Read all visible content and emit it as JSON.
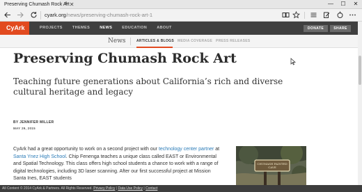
{
  "browser": {
    "tab_title": "Preserving Chumash Rock Art",
    "url_domain": "cyark.org",
    "url_path": "/news/preserving-chumash-rock-art-1",
    "new_tab": "+",
    "win_minimize": "—",
    "win_maximize": "☐",
    "win_close": "✕",
    "tab_close": "✕"
  },
  "site": {
    "logo": "CyArk",
    "nav": [
      "PROJECTS",
      "THEMES",
      "NEWS",
      "EDUCATION",
      "ABOUT"
    ],
    "active_nav": "NEWS",
    "donate": "DONATE",
    "share": "SHARE"
  },
  "subnav": {
    "title": "News",
    "links": [
      "ARTICLES & BLOGS",
      "MEDIA COVERAGE",
      "PRESS RELEASES"
    ]
  },
  "article": {
    "title": "Preserving Chumash Rock Art",
    "subtitle": "Teaching future generations about California’s rich and diverse cultural heritage and legacy",
    "byline": "BY JENNIFER MILLER",
    "date": "MAY 29, 2015",
    "body_1": "CyArk had a great opportunity to work on a second project with our ",
    "link_1": "technology center partner",
    "body_2": " at ",
    "link_2": "Santa Ynez High School",
    "body_3": ". Chip Fenenga teaches a unique class called EAST or Environmental and Spatial Technology. This class offers high school students a chance to work with a range of digital technologies, including 3D laser scanning. After our first successful project at Mission Santa Ines, EAST students",
    "photo_sign": "CHUMASH PAINTED CAVE"
  },
  "footer": {
    "copyright": "All Content © 2014 CyArk & Partners. All Rights Reserved. ",
    "privacy": "Privacy Policy",
    "sep": " | ",
    "data_use": "Data Use Policy",
    "contact": "Contact"
  },
  "icons": {
    "back": "back-arrow-icon",
    "forward": "forward-arrow-icon",
    "refresh": "refresh-icon",
    "reading_view": "reading-view-icon",
    "favorite": "star-icon",
    "hub": "hub-icon",
    "web_note": "web-note-icon",
    "share": "share-icon",
    "more": "more-icon"
  },
  "colors": {
    "brand": "#e24a1f",
    "header_bg": "#3f3f3f",
    "link": "#2a7bb7"
  }
}
